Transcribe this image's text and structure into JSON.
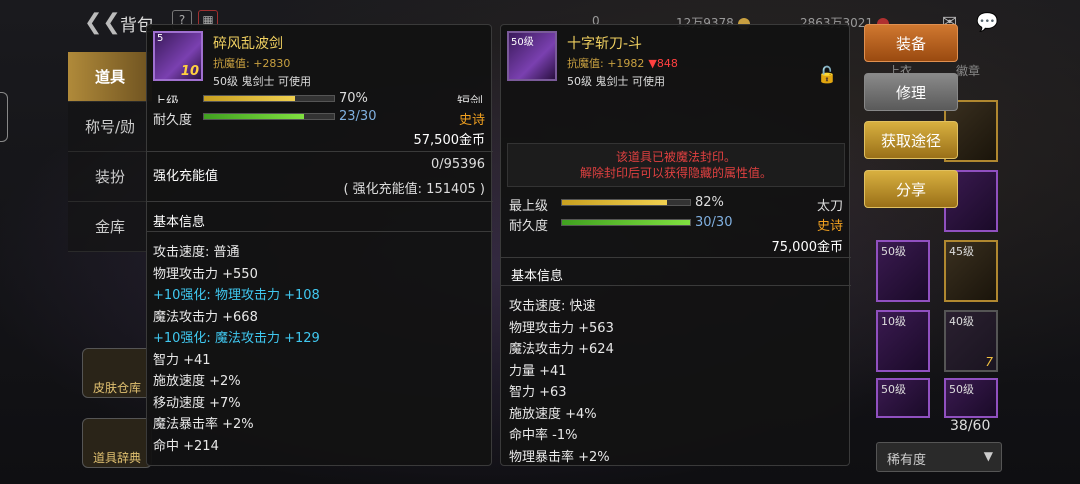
{
  "topbar": {
    "title": "背包",
    "gold_amount": "12万9378",
    "gem_amount": "2863万3021",
    "left_count": "0"
  },
  "sidebar": {
    "items": [
      {
        "label": "道具",
        "active": true
      },
      {
        "label": "称号/勋"
      },
      {
        "label": "装扮"
      },
      {
        "label": "金库"
      }
    ],
    "skin_btn": "皮肤仓库",
    "dict_btn": "道具辞典"
  },
  "left_item": {
    "level_badge": "5",
    "plus": "10",
    "name": "碎风乱波剑",
    "resist": "抗魔值: +2830",
    "requirement": "50级 鬼剑士 可使用",
    "top_label": "上级",
    "top_pct": "70%",
    "top_type": "短剑",
    "top_fill": 0.7,
    "durability_label": "耐久度",
    "durability": "23/30",
    "durability_fill": 0.77,
    "rarity": "史诗",
    "price": "57,500金币",
    "charge_label": "强化充能值",
    "charge_value": "0/95396",
    "charge_sub": "( 强化充能值: 151405 )",
    "section": "基本信息",
    "stats": [
      {
        "text": "攻击速度: 普通",
        "cyan": false
      },
      {
        "text": "物理攻击力 +550",
        "cyan": false
      },
      {
        "text": "+10强化: 物理攻击力 +108",
        "cyan": true
      },
      {
        "text": "魔法攻击力 +668",
        "cyan": false
      },
      {
        "text": "+10强化: 魔法攻击力 +129",
        "cyan": true
      },
      {
        "text": "智力 +41",
        "cyan": false
      },
      {
        "text": "施放速度 +2%",
        "cyan": false
      },
      {
        "text": "移动速度 +7%",
        "cyan": false
      },
      {
        "text": "魔法暴击率 +2%",
        "cyan": false
      },
      {
        "text": "命中 +214",
        "cyan": false
      }
    ]
  },
  "right_item": {
    "level_badge": "50级",
    "name": "十字斩刀-斗",
    "resist": "抗魔值: +1982",
    "resist_down": "▼848",
    "requirement": "50级 鬼剑士 可使用",
    "seal_line1": "该道具已被魔法封印。",
    "seal_line2": "解除封印后可以获得隐藏的属性值。",
    "top_label": "最上级",
    "top_pct": "82%",
    "top_type": "太刀",
    "top_fill": 0.82,
    "durability_label": "耐久度",
    "durability": "30/30",
    "durability_fill": 1.0,
    "rarity": "史诗",
    "price": "75,000金币",
    "section": "基本信息",
    "stats": [
      "攻击速度: 快速",
      "物理攻击力 +563",
      "魔法攻击力 +624",
      "力量 +41",
      "智力 +63",
      "施放速度 +4%",
      "命中率 -1%",
      "物理暴击率 +2%"
    ]
  },
  "actions": {
    "equip": "装备",
    "repair": "修理",
    "obtain": "获取途径",
    "share": "分享"
  },
  "inventory": {
    "tab_partial": "上衣",
    "tab_badge": "徽章",
    "count": "38/60",
    "rarity_select": "稀有度",
    "cells": [
      {
        "lvl": "50级",
        "num": ""
      },
      {
        "lvl": "45级",
        "num": ""
      },
      {
        "lvl": "40级",
        "num": "7"
      },
      {
        "lvl": "50级",
        "num": ""
      },
      {
        "lvl": "50级",
        "num": ""
      },
      {
        "lvl": "",
        "num": ""
      },
      {
        "lvl": "50级",
        "num": ""
      },
      {
        "lvl": "",
        "num": ""
      }
    ]
  },
  "colors": {
    "gold_text": "#f0d060",
    "rarity_epic": "#f0a020",
    "enhance_cyan": "#40c8f0",
    "seal_red": "#e04040"
  }
}
